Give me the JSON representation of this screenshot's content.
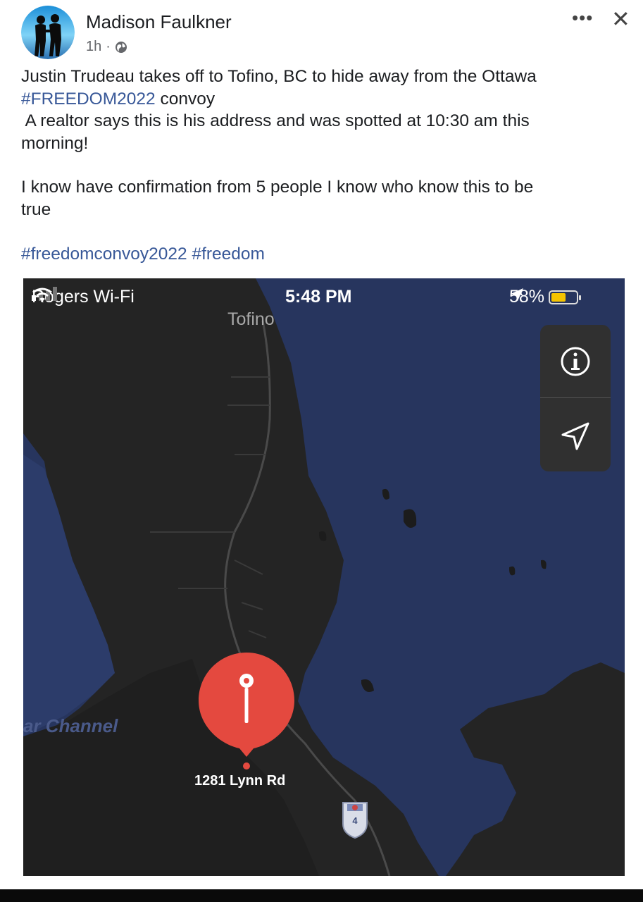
{
  "post": {
    "author": "Madison Faulkner",
    "time": "1h",
    "audience_icon": "globe-icon",
    "more_icon": "more-horizontal-icon",
    "close_icon": "close-icon"
  },
  "content": {
    "line1": "Justin Trudeau takes off to Tofino, BC to hide away from the Ottawa",
    "line2_tag": "#FREEDOM2022",
    "line2_rest": " convoy",
    "line3": " A realtor says this is his address and was spotted at 10:30 am this",
    "line4": "morning!",
    "line5": "I know have confirmation from 5 people I know who know this to be",
    "line6": "true",
    "hashtag1": "#freedomconvoy2022",
    "hashtag2": "#freedom"
  },
  "screenshot": {
    "status": {
      "carrier": "Rogers Wi-Fi",
      "time": "5:48 PM",
      "battery": "58%",
      "battery_level": 0.58
    },
    "map": {
      "city": "Tofino",
      "water": "ar Channel",
      "pin_address": "1281 Lynn Rd",
      "highway": "4",
      "info_icon": "info-icon",
      "location_icon": "navigation-arrow-icon"
    }
  },
  "colors": {
    "link": "#385898",
    "water": "#27355e",
    "land": "#242424",
    "pin": "#e4493f"
  }
}
